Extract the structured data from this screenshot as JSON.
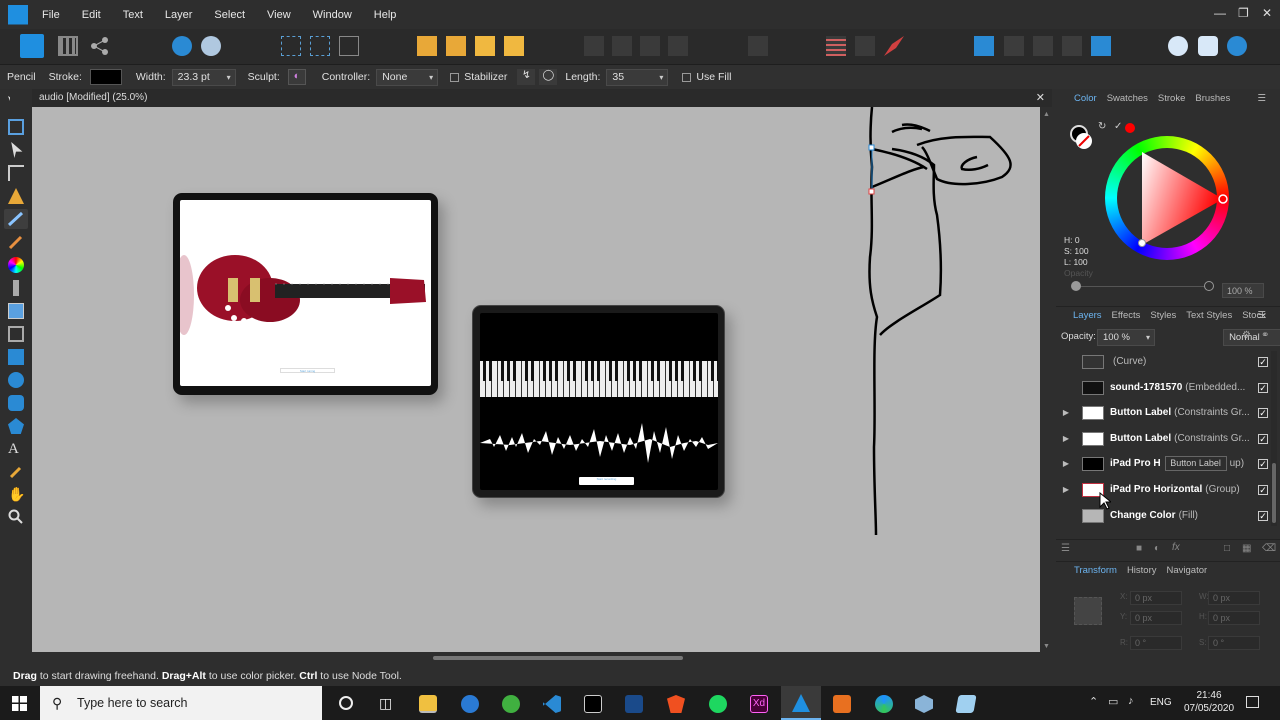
{
  "menu": [
    "File",
    "Edit",
    "Text",
    "Layer",
    "Select",
    "View",
    "Window",
    "Help"
  ],
  "context_bar": {
    "tool": "Pencil",
    "stroke_label": "Stroke:",
    "width_label": "Width:",
    "width_value": "23.3 pt",
    "sculpt_label": "Sculpt:",
    "controller_label": "Controller:",
    "controller_value": "None",
    "stabilizer_label": "Stabilizer",
    "length_label": "Length:",
    "length_value": "35",
    "use_fill_label": "Use Fill"
  },
  "document": {
    "tab_title": "audio [Modified] (25.0%)"
  },
  "canvas": {
    "ipad1_button": "Start tuning",
    "ipad2_button": "Start recording"
  },
  "color_panel": {
    "tabs": [
      "Color",
      "Swatches",
      "Stroke",
      "Brushes"
    ],
    "h": "H: 0",
    "s": "S: 100",
    "l": "L: 100",
    "opacity_label": "Opacity",
    "opacity_value": "100 %",
    "stroke_color": "#000000",
    "fill_color": "#ff0000"
  },
  "layers_panel": {
    "tabs": [
      "Layers",
      "Effects",
      "Styles",
      "Text Styles",
      "Stock"
    ],
    "opacity_label": "Opacity:",
    "opacity_value": "100 %",
    "blend_mode": "Normal",
    "rows": [
      {
        "name": "",
        "type": "(Curve)"
      },
      {
        "name": "sound-1781570",
        "type": "(Embedded..."
      },
      {
        "name": "Button Label",
        "type": "(Constraints Gr..."
      },
      {
        "name": "Button Label",
        "type": "(Constraints Gr..."
      },
      {
        "name": "iPad Pro H",
        "type": "up)"
      },
      {
        "name": "iPad Pro Horizontal",
        "type": "(Group)"
      },
      {
        "name": "Change Color",
        "type": "(Fill)"
      }
    ],
    "tooltip": "Button Label"
  },
  "transform_panel": {
    "tabs": [
      "Transform",
      "History",
      "Navigator"
    ],
    "x": "0 px",
    "y": "0 px",
    "w": "0 px",
    "h": "0 px",
    "r": "0 °",
    "s": "0 °",
    "x_label": "X:",
    "y_label": "Y:",
    "w_label": "W:",
    "h_label": "H:",
    "r_label": "R:",
    "s_label": "S:"
  },
  "status": {
    "drag": "Drag",
    "text1": " to start drawing freehand. ",
    "drag_alt": "Drag+Alt",
    "text2": " to use color picker. ",
    "ctrl": "Ctrl",
    "text3": " to use Node Tool."
  },
  "taskbar": {
    "search_placeholder": "Type here to search",
    "lang": "ENG",
    "time": "21:46",
    "date": "07/05/2020"
  }
}
